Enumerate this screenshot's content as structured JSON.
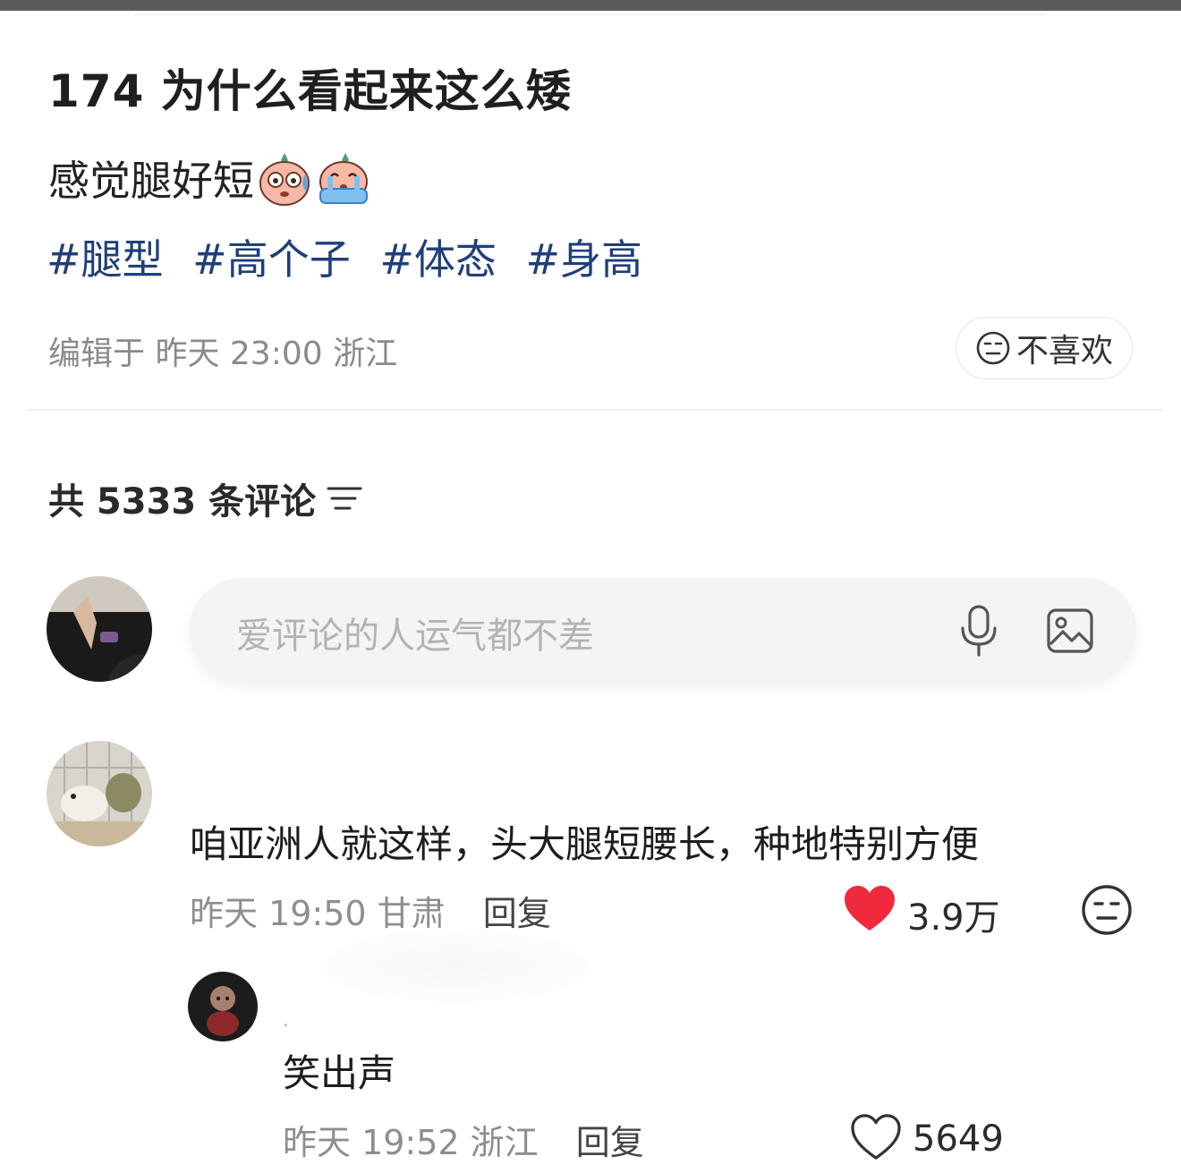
{
  "post": {
    "title": "174 为什么看起来这么矮",
    "body": "感觉腿好短",
    "emojis": [
      "sweating-face-emoji",
      "crying-face-emoji"
    ],
    "tags": [
      "#腿型",
      "#高个子",
      "#体态",
      "#身高"
    ],
    "meta": "编辑于 昨天 23:00 浙江",
    "dislike_label": "不喜欢"
  },
  "comments_header": {
    "label": "共 5333 条评论"
  },
  "comment_input": {
    "placeholder": "爱评论的人运气都不差"
  },
  "comments": [
    {
      "text": "咱亚洲人就这样，头大腿短腰长，种地特别方便",
      "time_location": "昨天 19:50 甘肃",
      "reply_label": "回复",
      "likes": "3.9万",
      "liked": true,
      "replies": [
        {
          "username": ".",
          "text": "笑出声",
          "time_location": "昨天 19:52 浙江",
          "reply_label": "回复",
          "likes": "5649",
          "liked": false
        }
      ]
    }
  ],
  "colors": {
    "tag": "#1f3f7a",
    "like_red": "#ef2a3c",
    "meta_gray": "#8a8a8a",
    "input_bg": "#f3f4f3"
  }
}
